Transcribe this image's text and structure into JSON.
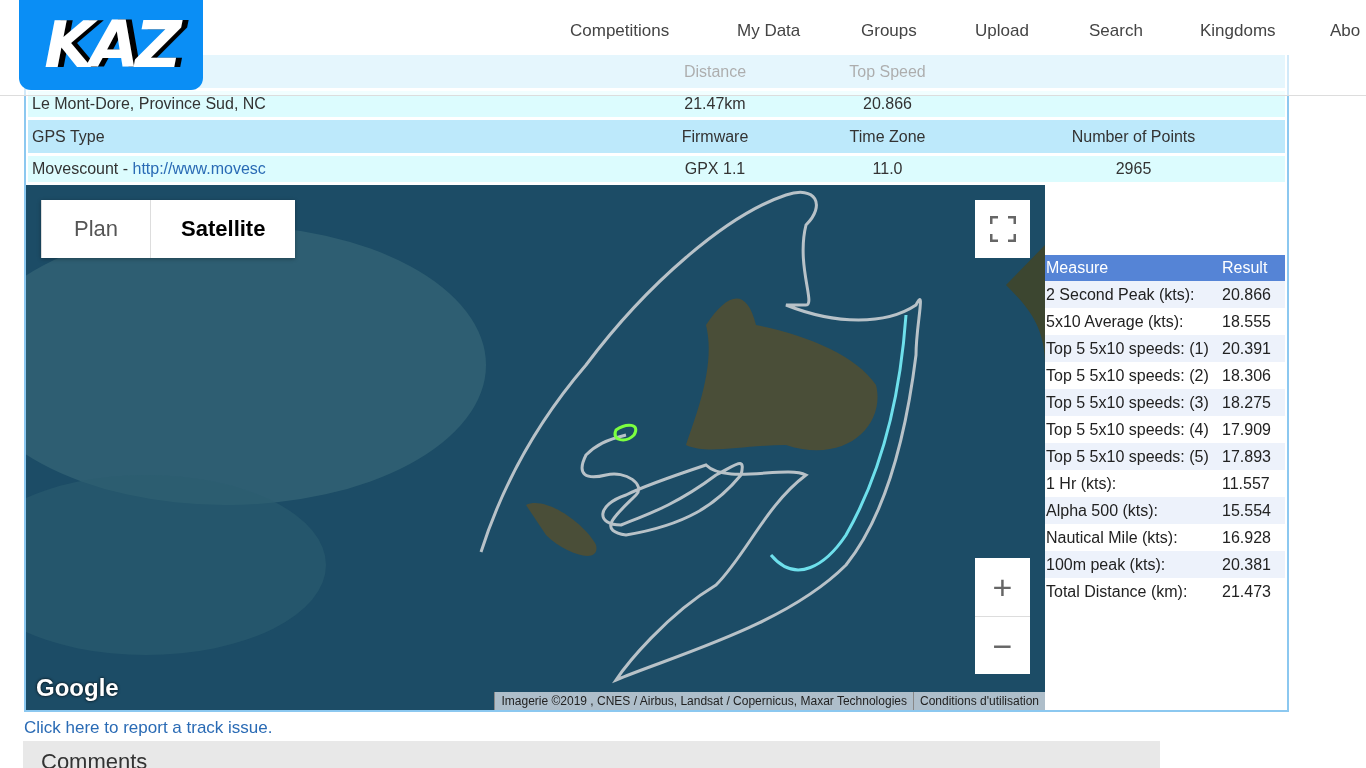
{
  "header": {
    "logo": "KAZ",
    "nav": [
      {
        "label": "Competitions"
      },
      {
        "label": "My Data"
      },
      {
        "label": "Groups"
      },
      {
        "label": "Upload"
      },
      {
        "label": "Search"
      },
      {
        "label": "Kingdoms"
      },
      {
        "label": "Abo"
      }
    ]
  },
  "info_table": [
    {
      "kind": "head",
      "cells": [
        "",
        "Distance",
        "Top Speed",
        ""
      ]
    },
    {
      "kind": "data",
      "cells": [
        "Le Mont-Dore, Province Sud, NC",
        "21.47km",
        "20.866",
        ""
      ]
    },
    {
      "kind": "head",
      "cells": [
        "GPS Type",
        "Firmware",
        "Time Zone",
        "Number of Points"
      ]
    },
    {
      "kind": "data",
      "cells": [
        "Movescount - ",
        "GPX 1.1",
        "11.0",
        "2965"
      ],
      "link": "http://www.movesc"
    }
  ],
  "map": {
    "map_types": [
      {
        "label": "Plan",
        "selected": false
      },
      {
        "label": "Satellite",
        "selected": true
      }
    ],
    "zoom_in": "+",
    "zoom_out": "−",
    "brand": "Google",
    "attribution": "Imagerie ©2019 , CNES / Airbus, Landsat / Copernicus, Maxar Technologies",
    "terms": "Conditions d'utilisation"
  },
  "results": {
    "columns": [
      "Measure",
      "Result"
    ],
    "rows": [
      {
        "measure": "2 Second Peak (kts):",
        "result": "20.866"
      },
      {
        "measure": "5x10 Average (kts):",
        "result": "18.555"
      },
      {
        "measure": "Top 5 5x10 speeds: (1)",
        "result": "20.391"
      },
      {
        "measure": "Top 5 5x10 speeds: (2)",
        "result": "18.306"
      },
      {
        "measure": "Top 5 5x10 speeds: (3)",
        "result": "18.275"
      },
      {
        "measure": "Top 5 5x10 speeds: (4)",
        "result": "17.909"
      },
      {
        "measure": "Top 5 5x10 speeds: (5)",
        "result": "17.893"
      },
      {
        "measure": "1 Hr (kts):",
        "result": "11.557"
      },
      {
        "measure": "Alpha 500 (kts):",
        "result": "15.554"
      },
      {
        "measure": "Nautical Mile (kts):",
        "result": "16.928"
      },
      {
        "measure": "100m peak (kts):",
        "result": "20.381"
      },
      {
        "measure": "Total Distance (km):",
        "result": "21.473"
      }
    ]
  },
  "report_link": "Click here to report a track issue.",
  "comments": {
    "title": "Comments"
  }
}
